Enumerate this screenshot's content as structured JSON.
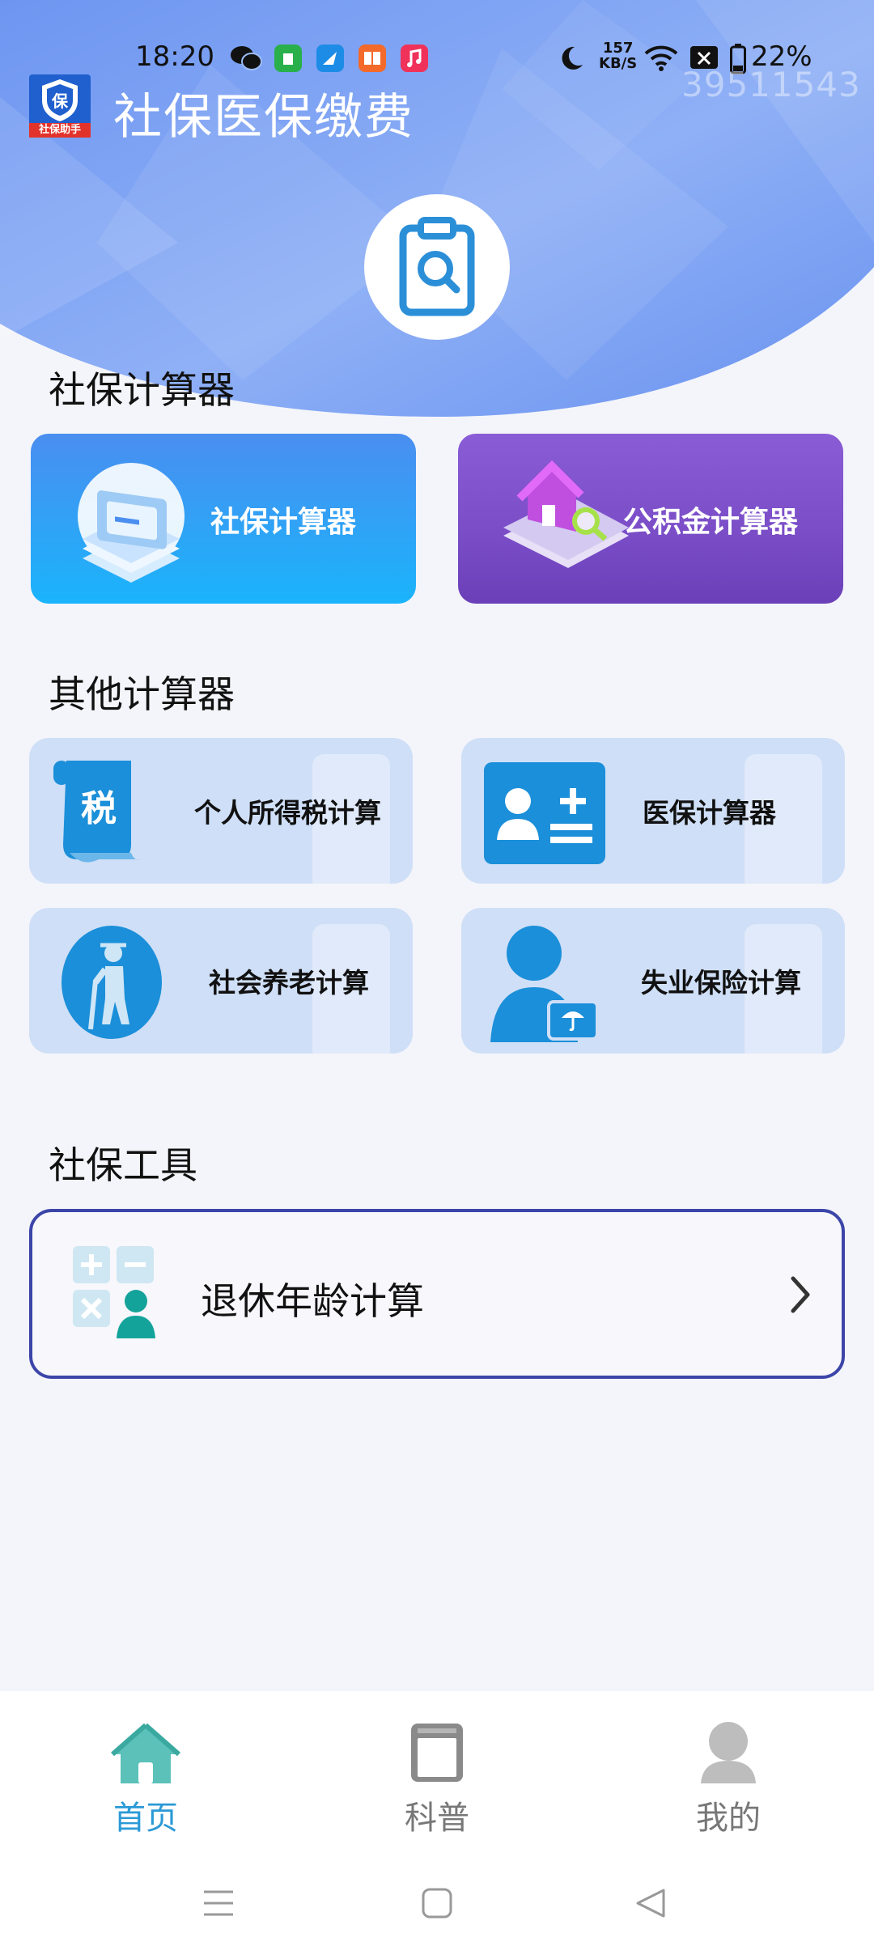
{
  "status_bar": {
    "time": "18:20",
    "net_speed_value": "157",
    "net_speed_unit": "KB/S",
    "battery": "22%",
    "notification_icons": [
      "wechat-icon",
      "android-store-icon",
      "browser-icon",
      "reader-icon",
      "music-icon"
    ],
    "system_icons": [
      "moon-icon",
      "wifi-icon",
      "no-sim-icon",
      "battery-icon"
    ]
  },
  "header": {
    "app_logo_caption": "社保助手",
    "app_logo_letter": "保",
    "title": "社保医保缴费",
    "watermark": "39511543"
  },
  "section_social": {
    "title": "社保计算器",
    "cards": [
      {
        "label": "社保计算器",
        "icon": "documents-stack-icon"
      },
      {
        "label": "公积金计算器",
        "icon": "house-search-icon"
      }
    ]
  },
  "section_other": {
    "title": "其他计算器",
    "cards": [
      {
        "label": "个人所得税计算",
        "icon": "tax-scroll-icon",
        "icon_text": "税"
      },
      {
        "label": "医保计算器",
        "icon": "id-card-plus-minus-icon"
      },
      {
        "label": "社会养老计算",
        "icon": "elderly-person-icon"
      },
      {
        "label": "失业保险计算",
        "icon": "person-umbrella-card-icon"
      }
    ]
  },
  "section_tools": {
    "title": "社保工具",
    "items": [
      {
        "label": "退休年龄计算",
        "icon": "calculator-person-icon"
      }
    ]
  },
  "bottom_nav": {
    "items": [
      {
        "label": "首页",
        "icon": "home-icon",
        "active": true
      },
      {
        "label": "科普",
        "icon": "book-icon",
        "active": false
      },
      {
        "label": "我的",
        "icon": "profile-icon",
        "active": false
      }
    ]
  },
  "colors": {
    "header_blue": "#6f9af2",
    "card_blue": "#1ab4fb",
    "card_purple": "#7d52cc",
    "small_card_bg": "#cfdff7",
    "icon_blue": "#1b8fd9",
    "nav_active": "#2b9ad6",
    "nav_inactive": "#8a8a8a",
    "tool_border": "#3c45a8"
  }
}
